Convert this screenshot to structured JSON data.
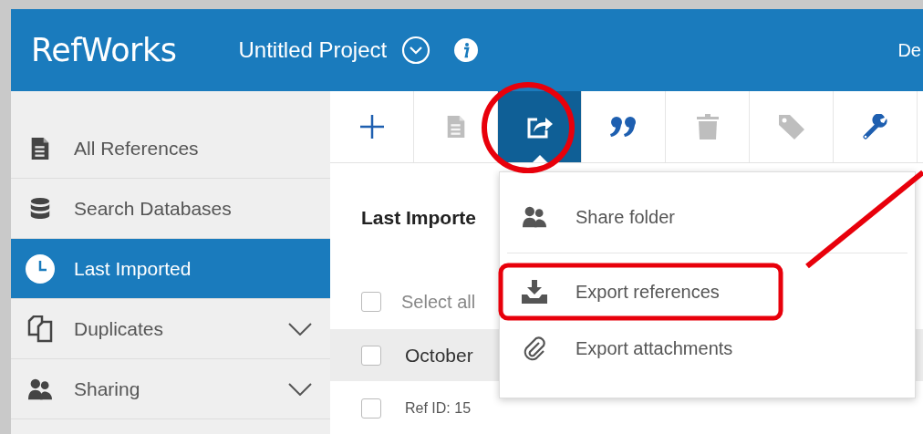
{
  "header": {
    "logo": "RefWorks",
    "project_title": "Untitled Project",
    "user_menu": "De"
  },
  "sidebar": {
    "items": [
      {
        "label": "All References",
        "selected": false,
        "expandable": false
      },
      {
        "label": "Search Databases",
        "selected": false,
        "expandable": false
      },
      {
        "label": "Last Imported",
        "selected": true,
        "expandable": false
      },
      {
        "label": "Duplicates",
        "selected": false,
        "expandable": true
      },
      {
        "label": "Sharing",
        "selected": false,
        "expandable": true
      }
    ]
  },
  "toolbar": {
    "buttons": [
      {
        "disabled": false,
        "selected": false
      },
      {
        "disabled": true,
        "selected": false
      },
      {
        "disabled": false,
        "selected": true
      },
      {
        "disabled": false,
        "selected": false
      },
      {
        "disabled": true,
        "selected": false
      },
      {
        "disabled": true,
        "selected": false
      },
      {
        "disabled": false,
        "selected": false
      }
    ]
  },
  "content": {
    "title": "Last Importe",
    "select_all": {
      "label": "Select all",
      "checked": false
    },
    "group": {
      "label": "October",
      "checked": false
    },
    "reference": {
      "label": "Ref ID: 15",
      "checked": false
    }
  },
  "share_menu": {
    "items": [
      {
        "label": "Share folder"
      },
      {
        "label": "Export references"
      },
      {
        "label": "Export attachments"
      }
    ]
  }
}
